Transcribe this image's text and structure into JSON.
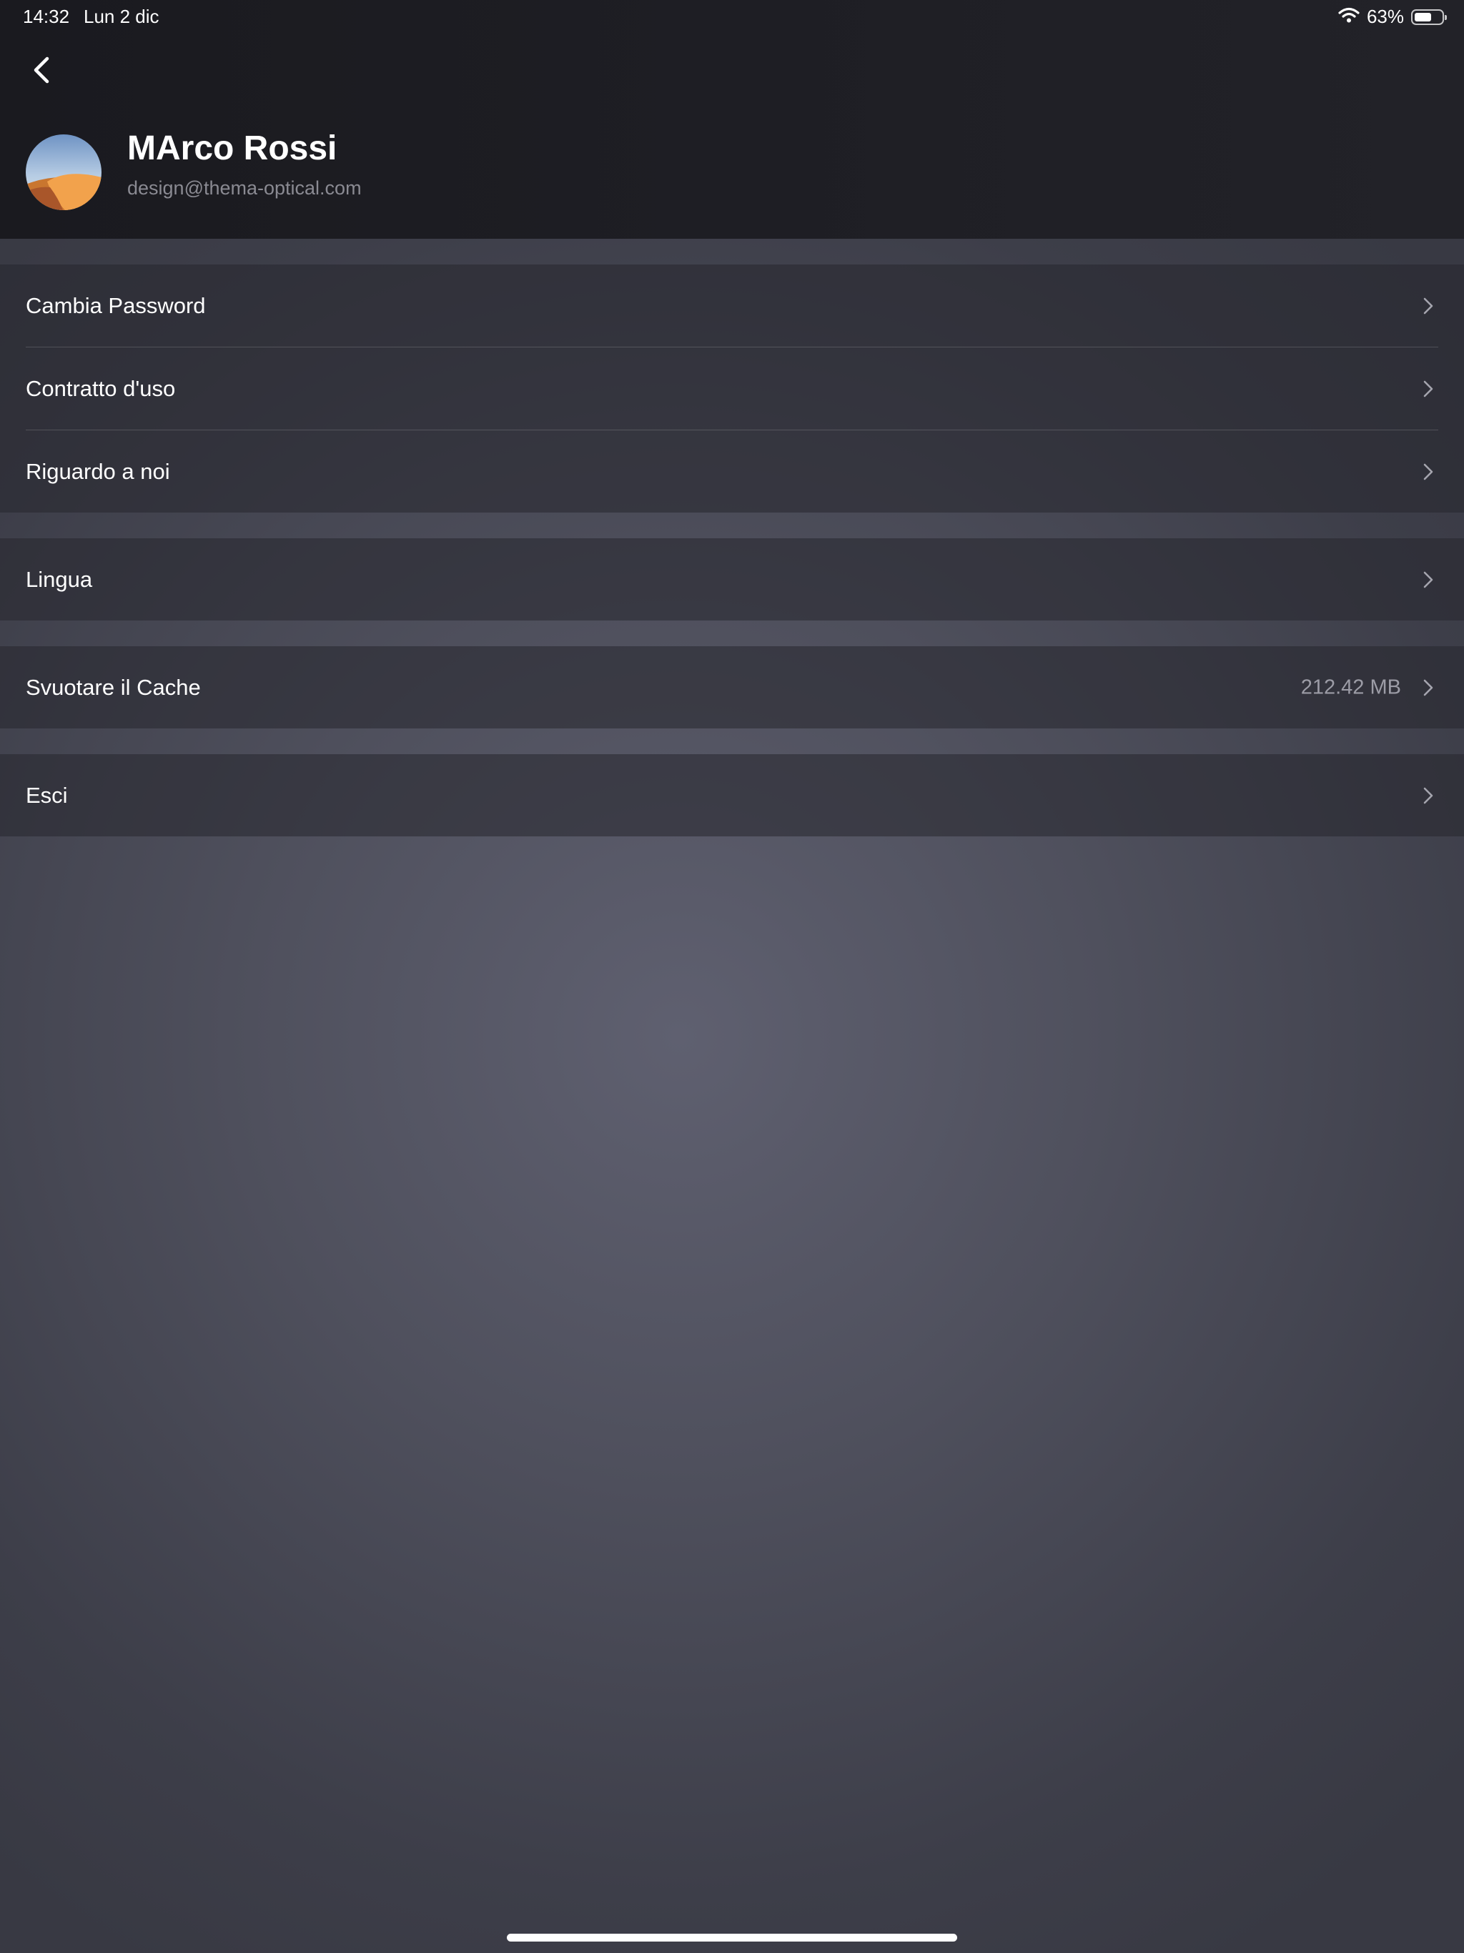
{
  "status_bar": {
    "time": "14:32",
    "date": "Lun 2 dic",
    "battery_percent": "63%",
    "battery_level": 0.63,
    "icons": [
      "wifi-icon",
      "battery-icon"
    ]
  },
  "header": {
    "back_icon": "chevron-left-icon",
    "user": {
      "name": "MArco Rossi",
      "email": "design@thema-optical.com"
    }
  },
  "settings": {
    "group_account": {
      "items": [
        {
          "label": "Cambia Password",
          "icon": "chevron-right-icon"
        },
        {
          "label": "Contratto d'uso",
          "icon": "chevron-right-icon"
        },
        {
          "label": "Riguardo a noi",
          "icon": "chevron-right-icon"
        }
      ]
    },
    "group_language": {
      "items": [
        {
          "label": "Lingua",
          "icon": "chevron-right-icon"
        }
      ]
    },
    "group_cache": {
      "items": [
        {
          "label": "Svuotare il Cache",
          "value": "212.42 MB",
          "icon": "chevron-right-icon"
        }
      ]
    },
    "group_logout": {
      "items": [
        {
          "label": "Esci",
          "icon": "chevron-right-icon"
        }
      ]
    }
  },
  "colors": {
    "header_bg": "#1e1e24",
    "background": "#4f505d",
    "secondary_text": "#8a8a92",
    "value_text": "#9c9ca6"
  }
}
